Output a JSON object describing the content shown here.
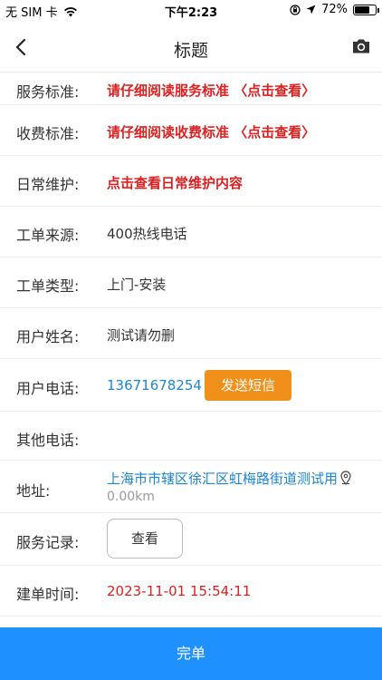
{
  "status_bar": {
    "carrier": "无 SIM 卡",
    "time": "下午2:23",
    "battery_percent": "72%",
    "battery_level": 0.72
  },
  "nav": {
    "title": "标题"
  },
  "fields": {
    "service_standard": {
      "label": "服务标准:",
      "value": "请仔细阅读服务标准 〈点击查看〉"
    },
    "fee_standard": {
      "label": "收费标准:",
      "value": "请仔细阅读收费标准 〈点击查看〉"
    },
    "daily_maintenance": {
      "label": "日常维护:",
      "value": "点击查看日常维护内容"
    },
    "order_source": {
      "label": "工单来源:",
      "value": "400热线电话"
    },
    "order_type": {
      "label": "工单类型:",
      "value": "上门-安装"
    },
    "user_name": {
      "label": "用户姓名:",
      "value": "测试请勿删"
    },
    "user_phone": {
      "label": "用户电话:",
      "value": "13671678254",
      "sms_button": "发送短信"
    },
    "other_phone": {
      "label": "其他电话:",
      "value": ""
    },
    "address": {
      "label": "地址:",
      "value": "上海市市辖区徐汇区虹梅路街道测试用",
      "distance": "0.00km"
    },
    "service_record": {
      "label": "服务记录:",
      "button": "查看"
    },
    "created_time": {
      "label": "建单时间:",
      "value": "2023-11-01 15:54:11"
    }
  },
  "footer": {
    "complete_label": "完单"
  },
  "colors": {
    "accent_blue": "#1e90ff",
    "link_blue": "#1c86d6",
    "warning_red": "#e02020",
    "sms_orange": "#f08f1a"
  }
}
